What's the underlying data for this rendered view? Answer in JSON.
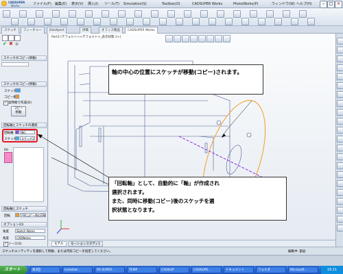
{
  "app": {
    "logo_line1": "CADSUPER",
    "logo_line2": "Works"
  },
  "menu": [
    "ファイル(F)",
    "編集(E)",
    "表示(V)",
    "挿入(I)",
    "ツール(T)",
    "Simulation(S)",
    "Toolbox(O)",
    "CADSUPER Works",
    "PhotoWorks(P)",
    "ウィンドウ(W)",
    "ヘルプ(H)"
  ],
  "tabs": [
    "スケッチ",
    "フィーチャー",
    "DimXpert",
    "評価",
    "オフィス製品",
    "CADSUPER Works"
  ],
  "tree_item": "Part3 (デフォルト<<デフォルト>_表示状態 1>)",
  "left_panel": {
    "feature_name": "スケッチのコピー(移動)",
    "sec1_title": "スケッチのコピー(移動)",
    "sketch_label": "スケッチ",
    "copy_label": "コピー数",
    "real_time_label": "実時間で作成(D)",
    "copy_btn": "コピー",
    "move_btn": "移動",
    "sec2_title": "回転軸とスケッチの選択",
    "axis_label": "回転軸",
    "axis_value": "軸1",
    "sketch2_label": "スケッチ",
    "sketch2_value": "スケッチ3",
    "preview_label": "R0",
    "sec3_title": "回転軸とスケッチ",
    "angle_label": "回転",
    "angle_value": "円形コピー時の回転",
    "options_title": "オプション(O)",
    "opt_row1_label": "角度",
    "opt_row1_value": "Sketch Works",
    "opt_row2_label": "角度",
    "opt_row2_value": "CADWorks",
    "chk1": "ソース(S)",
    "chk2": "プレビュー表示(V)"
  },
  "callouts": {
    "top": "軸の中心の位置にスケッチが移動(コピー)されます。",
    "bottom_line1": "「回転軸」として、自動的に「軸」が作成され",
    "bottom_line2": "選択されます。",
    "bottom_line3": "また、同時に移動(コピー)後のスケッチを選",
    "bottom_line4": "択状態となります。"
  },
  "bottom_tabs": [
    "モデル",
    "モーションスタディ1"
  ],
  "status": {
    "message": "スケッチエンティティを選択して移動、または円形コピーを指定してください。",
    "mode": "編集中: 部品"
  },
  "taskbar": {
    "start": "スタート",
    "tasks": [
      "第3回",
      "Installati...",
      "RS SUPER...",
      "TEMP",
      "CADSUP",
      "CADSUPE...",
      "ドキュメント",
      "フォルダ",
      "Microsoft..."
    ],
    "clock": "16:11"
  },
  "colors": {
    "highlight_red": "#e8141e",
    "sketch_orange": "#f39c1c",
    "axis_purple": "#8a2be2",
    "model_line": "#4a5a8f"
  }
}
